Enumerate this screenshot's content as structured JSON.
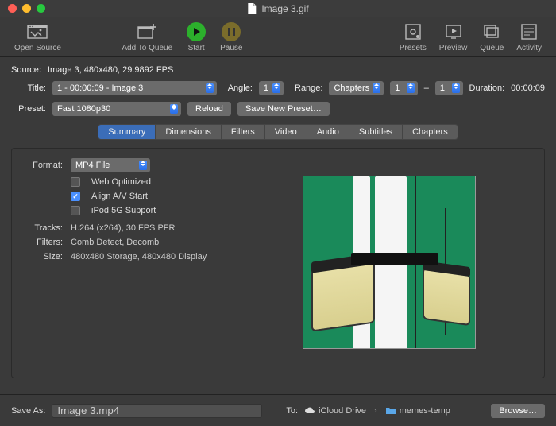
{
  "window": {
    "title": "Image 3.gif"
  },
  "toolbar": {
    "open_source": "Open Source",
    "add_to_queue": "Add To Queue",
    "start": "Start",
    "pause": "Pause",
    "presets": "Presets",
    "preview": "Preview",
    "queue": "Queue",
    "activity": "Activity"
  },
  "source": {
    "label": "Source:",
    "value": "Image 3, 480x480, 29.9892 FPS"
  },
  "title": {
    "label": "Title:",
    "value": "1 - 00:00:09 - Image 3"
  },
  "angle": {
    "label": "Angle:",
    "value": "1"
  },
  "range": {
    "label": "Range:",
    "type": "Chapters",
    "from": "1",
    "dash": "–",
    "to": "1"
  },
  "duration": {
    "label": "Duration:",
    "value": "00:00:09"
  },
  "preset": {
    "label": "Preset:",
    "value": "Fast 1080p30",
    "reload": "Reload",
    "save_new": "Save New Preset…"
  },
  "tabs": {
    "summary": "Summary",
    "dimensions": "Dimensions",
    "filters": "Filters",
    "video": "Video",
    "audio": "Audio",
    "subtitles": "Subtitles",
    "chapters": "Chapters"
  },
  "summary": {
    "format_label": "Format:",
    "format_value": "MP4 File",
    "web_optimized": "Web Optimized",
    "align_av": "Align A/V Start",
    "ipod_5g": "iPod 5G Support",
    "tracks_label": "Tracks:",
    "tracks_value": "H.264 (x264), 30 FPS PFR",
    "filters_label": "Filters:",
    "filters_value": "Comb Detect, Decomb",
    "size_label": "Size:",
    "size_value": "480x480 Storage, 480x480 Display"
  },
  "saveas": {
    "label": "Save As:",
    "value": "Image 3.mp4",
    "to_label": "To:",
    "path_root": "iCloud Drive",
    "path_folder": "memes-temp",
    "browse": "Browse…"
  }
}
